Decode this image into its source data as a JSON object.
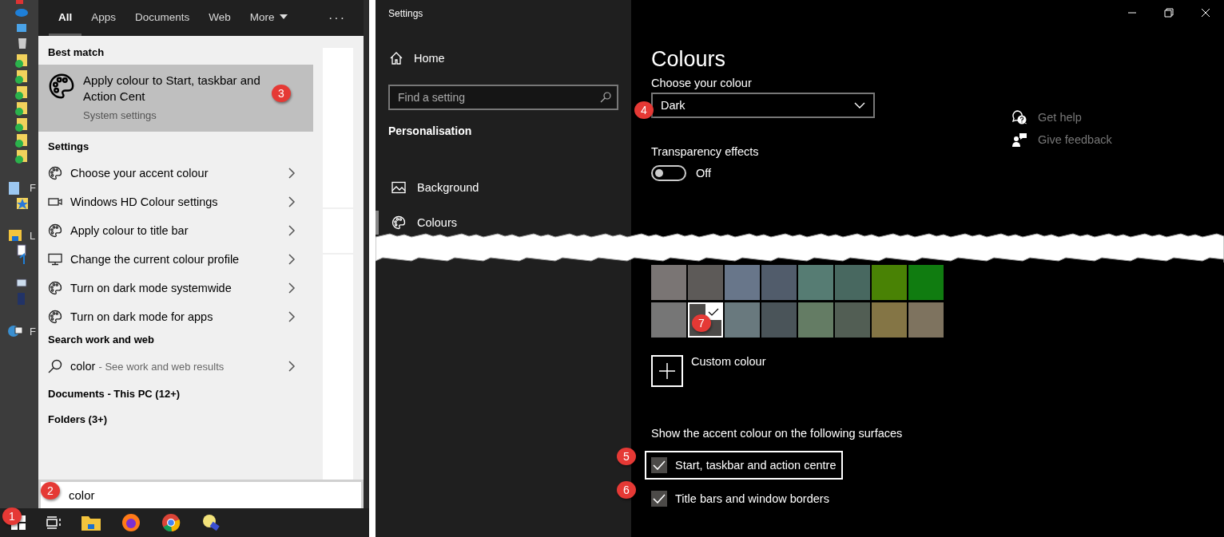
{
  "desktop": {
    "labels": [
      "F",
      "L",
      "F"
    ]
  },
  "search": {
    "tabs": [
      {
        "label": "All",
        "selected": true,
        "kind": "tab"
      },
      {
        "label": "Apps",
        "selected": false,
        "kind": "tab"
      },
      {
        "label": "Documents",
        "selected": false,
        "kind": "tab"
      },
      {
        "label": "Web",
        "selected": false,
        "kind": "tab"
      },
      {
        "label": "More",
        "selected": false,
        "kind": "menu"
      }
    ],
    "overflow": "···",
    "best_match": {
      "heading": "Best match",
      "title": "Apply colour to Start, taskbar and Action Cent",
      "subtitle": "System settings",
      "selected": true
    },
    "settings": {
      "heading": "Settings",
      "items": [
        {
          "label": "Choose your accent colour",
          "kind": "palette"
        },
        {
          "label": "Windows HD Colour settings",
          "kind": "hd"
        },
        {
          "label": "Apply colour to title bar",
          "kind": "palette"
        },
        {
          "label": "Change the current colour profile",
          "kind": "display"
        },
        {
          "label": "Turn on dark mode systemwide",
          "kind": "palette"
        },
        {
          "label": "Turn on dark mode for apps",
          "kind": "palette"
        }
      ]
    },
    "web": {
      "heading": "Search work and web",
      "query": "color",
      "hint": "- See work and web results"
    },
    "groups": [
      "Documents - This PC (12+)",
      "Folders (3+)"
    ],
    "box": {
      "value": "color"
    }
  },
  "settings_window": {
    "title": "Settings",
    "nav": {
      "home": "Home",
      "search_placeholder": "Find a setting",
      "section": "Personalisation",
      "items": [
        {
          "label": "Background",
          "kind": "background",
          "selected": false
        },
        {
          "label": "Colours",
          "kind": "colours",
          "selected": true
        }
      ]
    },
    "page": {
      "title": "Colours",
      "choose_label": "Choose your colour",
      "dropdown": {
        "value": "Dark"
      },
      "transparency": {
        "label": "Transparency effects",
        "on": false,
        "state_text": "Off"
      },
      "swatches": [
        {
          "color": "#7a7574",
          "selected": false
        },
        {
          "color": "#5d5a58",
          "selected": false
        },
        {
          "color": "#68768a",
          "selected": false
        },
        {
          "color": "#515c6b",
          "selected": false
        },
        {
          "color": "#567c73",
          "selected": false
        },
        {
          "color": "#486860",
          "selected": false
        },
        {
          "color": "#498205",
          "selected": false
        },
        {
          "color": "#107c10",
          "selected": false
        },
        {
          "color": "#767676",
          "selected": false
        },
        {
          "color": "#4c4a48",
          "selected": true
        },
        {
          "color": "#69797e",
          "selected": false
        },
        {
          "color": "#4a5459",
          "selected": false
        },
        {
          "color": "#647c64",
          "selected": false
        },
        {
          "color": "#525e54",
          "selected": false
        },
        {
          "color": "#847545",
          "selected": false
        },
        {
          "color": "#7e735f",
          "selected": false
        }
      ],
      "custom": "Custom colour",
      "surfaces": {
        "heading": "Show the accent colour on the following surfaces",
        "options": [
          {
            "label": "Start, taskbar and action centre",
            "checked": true,
            "focused": true
          },
          {
            "label": "Title bars and window borders",
            "checked": true,
            "focused": false
          }
        ]
      },
      "links": [
        {
          "label": "Get help",
          "kind": "help"
        },
        {
          "label": "Give feedback",
          "kind": "feedback"
        }
      ]
    }
  },
  "annotations": [
    "1",
    "2",
    "3",
    "4",
    "5",
    "6",
    "7"
  ]
}
